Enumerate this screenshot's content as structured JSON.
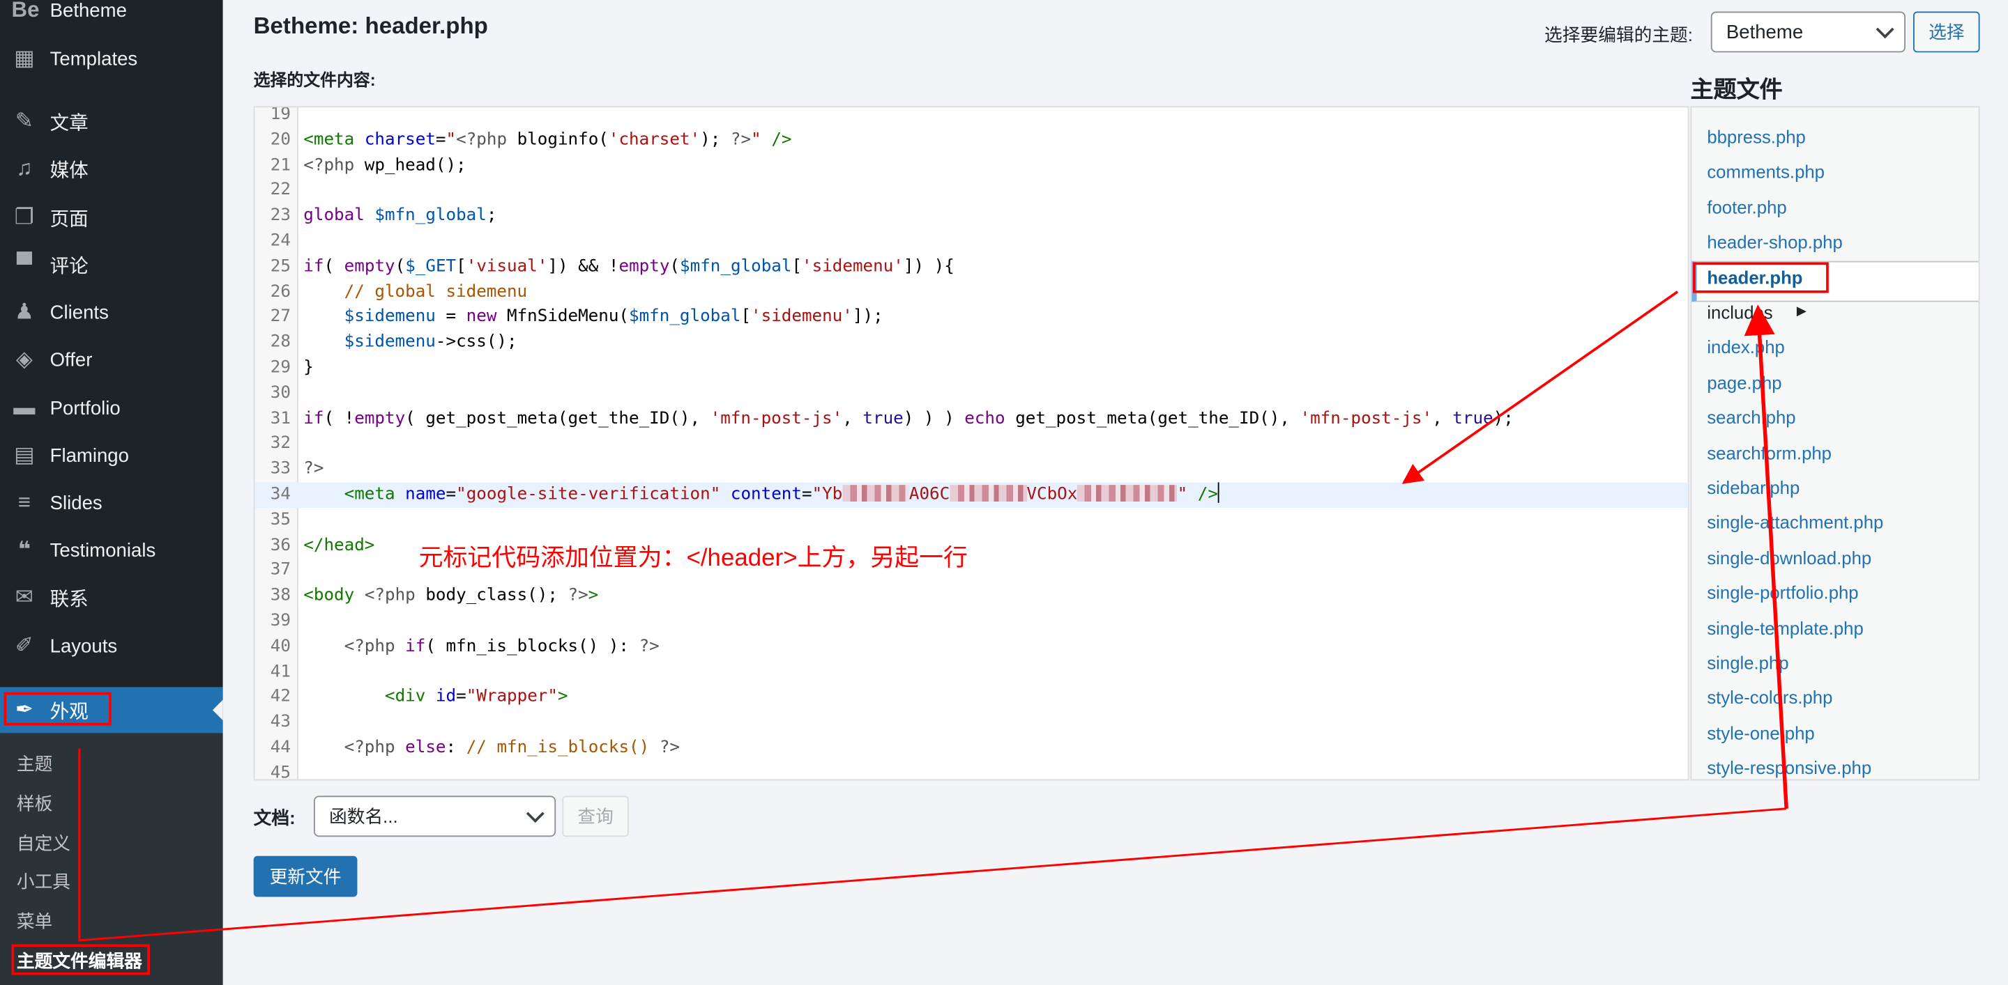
{
  "sidebar": {
    "items": [
      {
        "label": "Betheme",
        "icon": "betheme-logo-icon",
        "glyph": "Be"
      },
      {
        "label": "Templates",
        "icon": "templates-icon",
        "glyph": "▦"
      },
      {
        "label": "文章",
        "icon": "pin-icon",
        "glyph": "✎"
      },
      {
        "label": "媒体",
        "icon": "media-icon",
        "glyph": "♫"
      },
      {
        "label": "页面",
        "icon": "pages-icon",
        "glyph": "❐"
      },
      {
        "label": "评论",
        "icon": "comment-icon",
        "glyph": "▀"
      },
      {
        "label": "Clients",
        "icon": "user-icon",
        "glyph": "♟"
      },
      {
        "label": "Offer",
        "icon": "tag-icon",
        "glyph": "◈"
      },
      {
        "label": "Portfolio",
        "icon": "folder-icon",
        "glyph": "▬"
      },
      {
        "label": "Flamingo",
        "icon": "id-card-icon",
        "glyph": "▤"
      },
      {
        "label": "Slides",
        "icon": "slides-icon",
        "glyph": "≡"
      },
      {
        "label": "Testimonials",
        "icon": "quote-icon",
        "glyph": "❝"
      },
      {
        "label": "联系",
        "icon": "mail-icon",
        "glyph": "✉"
      },
      {
        "label": "Layouts",
        "icon": "brush-icon",
        "glyph": "✐"
      },
      {
        "label": "外观",
        "icon": "paintbrush-icon",
        "glyph": "✒",
        "active": true
      }
    ],
    "submenu": [
      "主题",
      "样板",
      "自定义",
      "小工具",
      "菜单",
      "主题文件编辑器"
    ]
  },
  "header": {
    "title": "Betheme: header.php",
    "file_content_label": "选择的文件内容:",
    "theme_select_label": "选择要编辑的主题:",
    "theme_selected": "Betheme",
    "select_button": "选择"
  },
  "files": {
    "title": "主题文件",
    "items": [
      "bbpress.php",
      "comments.php",
      "footer.php",
      "header-shop.php",
      "header.php",
      "includes",
      "index.php",
      "page.php",
      "search.php",
      "searchform.php",
      "sidebar.php",
      "single-attachment.php",
      "single-download.php",
      "single-portfolio.php",
      "single-template.php",
      "single.php",
      "style-colors.php",
      "style-one.php",
      "style-responsive.php"
    ],
    "selected": "header.php",
    "folder_arrow": "▶"
  },
  "editor": {
    "lines": [
      {
        "n": "19",
        "t": []
      },
      {
        "n": "20",
        "t": [
          [
            "tag",
            "<meta"
          ],
          [
            "plain",
            " "
          ],
          [
            "attr",
            "charset"
          ],
          [
            "plain",
            "="
          ],
          [
            "str",
            "\""
          ],
          [
            "meta",
            "<?php"
          ],
          [
            "plain",
            " bloginfo("
          ],
          [
            "str",
            "'charset'"
          ],
          [
            "plain",
            "); "
          ],
          [
            "meta",
            "?>"
          ],
          [
            "str",
            "\""
          ],
          [
            "plain",
            " "
          ],
          [
            "tag",
            "/>"
          ]
        ]
      },
      {
        "n": "21",
        "t": [
          [
            "meta",
            "<?php"
          ],
          [
            "plain",
            " wp_head();"
          ]
        ]
      },
      {
        "n": "22",
        "t": []
      },
      {
        "n": "23",
        "t": [
          [
            "kw",
            "global"
          ],
          [
            "plain",
            " "
          ],
          [
            "var",
            "$mfn_global"
          ],
          [
            "plain",
            ";"
          ]
        ]
      },
      {
        "n": "24",
        "t": []
      },
      {
        "n": "25",
        "t": [
          [
            "kw",
            "if"
          ],
          [
            "plain",
            "( "
          ],
          [
            "kw",
            "empty"
          ],
          [
            "plain",
            "("
          ],
          [
            "var",
            "$_GET"
          ],
          [
            "plain",
            "["
          ],
          [
            "str",
            "'visual'"
          ],
          [
            "plain",
            "]) && !"
          ],
          [
            "kw",
            "empty"
          ],
          [
            "plain",
            "("
          ],
          [
            "var",
            "$mfn_global"
          ],
          [
            "plain",
            "["
          ],
          [
            "str",
            "'sidemenu'"
          ],
          [
            "plain",
            "]) ){"
          ]
        ]
      },
      {
        "n": "26",
        "t": [
          [
            "plain",
            "    "
          ],
          [
            "com",
            "// global sidemenu"
          ]
        ]
      },
      {
        "n": "27",
        "t": [
          [
            "plain",
            "    "
          ],
          [
            "var",
            "$sidemenu"
          ],
          [
            "plain",
            " = "
          ],
          [
            "kw",
            "new"
          ],
          [
            "plain",
            " MfnSideMenu("
          ],
          [
            "var",
            "$mfn_global"
          ],
          [
            "plain",
            "["
          ],
          [
            "str",
            "'sidemenu'"
          ],
          [
            "plain",
            "]);"
          ]
        ]
      },
      {
        "n": "28",
        "t": [
          [
            "plain",
            "    "
          ],
          [
            "var",
            "$sidemenu"
          ],
          [
            "plain",
            "->css();"
          ]
        ]
      },
      {
        "n": "29",
        "t": [
          [
            "plain",
            "}"
          ]
        ]
      },
      {
        "n": "30",
        "t": []
      },
      {
        "n": "31",
        "t": [
          [
            "kw",
            "if"
          ],
          [
            "plain",
            "( !"
          ],
          [
            "kw",
            "empty"
          ],
          [
            "plain",
            "( get_post_meta(get_the_ID(), "
          ],
          [
            "str",
            "'mfn-post-js'"
          ],
          [
            "plain",
            ", "
          ],
          [
            "atom",
            "true"
          ],
          [
            "plain",
            ") ) ) "
          ],
          [
            "kw",
            "echo"
          ],
          [
            "plain",
            " get_post_meta(get_the_ID(), "
          ],
          [
            "str",
            "'mfn-post-js'"
          ],
          [
            "plain",
            ", "
          ],
          [
            "atom",
            "true"
          ],
          [
            "plain",
            ");"
          ]
        ]
      },
      {
        "n": "32",
        "t": []
      },
      {
        "n": "33",
        "t": [
          [
            "meta",
            "?>"
          ]
        ]
      },
      {
        "n": "34",
        "hl": true,
        "t": [
          [
            "plain",
            "    "
          ],
          [
            "tag",
            "<meta"
          ],
          [
            "plain",
            " "
          ],
          [
            "attr",
            "name"
          ],
          [
            "plain",
            "="
          ],
          [
            "str",
            "\"google-site-verification\""
          ],
          [
            "plain",
            " "
          ],
          [
            "attr",
            "content"
          ],
          [
            "plain",
            "="
          ],
          [
            "str",
            "\"Yb"
          ],
          [
            "blur",
            ""
          ],
          [
            "str",
            "A06C"
          ],
          [
            "blur",
            ""
          ],
          [
            "str",
            "VCbOx"
          ],
          [
            "blur",
            ""
          ],
          [
            "str",
            "\""
          ],
          [
            "plain",
            " "
          ],
          [
            "tag",
            "/>"
          ],
          [
            "cursor",
            ""
          ]
        ]
      },
      {
        "n": "35",
        "t": []
      },
      {
        "n": "36",
        "t": [
          [
            "tag",
            "</head>"
          ]
        ]
      },
      {
        "n": "37",
        "t": []
      },
      {
        "n": "38",
        "t": [
          [
            "tag",
            "<body"
          ],
          [
            "plain",
            " "
          ],
          [
            "meta",
            "<?php"
          ],
          [
            "plain",
            " body_class(); "
          ],
          [
            "meta",
            "?>"
          ],
          [
            "tag",
            ">"
          ]
        ]
      },
      {
        "n": "39",
        "t": []
      },
      {
        "n": "40",
        "t": [
          [
            "plain",
            "    "
          ],
          [
            "meta",
            "<?php"
          ],
          [
            "plain",
            " "
          ],
          [
            "kw",
            "if"
          ],
          [
            "plain",
            "( mfn_is_blocks() ): "
          ],
          [
            "meta",
            "?>"
          ]
        ]
      },
      {
        "n": "41",
        "t": []
      },
      {
        "n": "42",
        "t": [
          [
            "plain",
            "        "
          ],
          [
            "tag",
            "<div"
          ],
          [
            "plain",
            " "
          ],
          [
            "attr",
            "id"
          ],
          [
            "plain",
            "="
          ],
          [
            "str",
            "\"Wrapper\""
          ],
          [
            "tag",
            ">"
          ]
        ]
      },
      {
        "n": "43",
        "t": []
      },
      {
        "n": "44",
        "t": [
          [
            "plain",
            "    "
          ],
          [
            "meta",
            "<?php"
          ],
          [
            "plain",
            " "
          ],
          [
            "kw",
            "else"
          ],
          [
            "plain",
            ": "
          ],
          [
            "com",
            "// mfn_is_blocks()"
          ],
          [
            "plain",
            " "
          ],
          [
            "meta",
            "?>"
          ]
        ]
      },
      {
        "n": "45",
        "t": []
      }
    ]
  },
  "annotation": "元标记代码添加位置为：</header>上方，另起一行",
  "footer": {
    "docs_label": "文档:",
    "docs_placeholder": "函数名...",
    "lookup_button": "查询",
    "update_button": "更新文件"
  },
  "colors": {
    "accent": "#2271b1",
    "sidebar": "#1d2327",
    "annotation": "#ff0000"
  }
}
